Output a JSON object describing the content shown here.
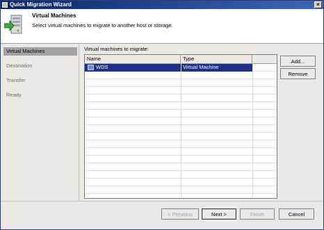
{
  "window": {
    "title": "Quick Migration Wizard"
  },
  "header": {
    "title": "Virtual Machines",
    "subtitle": "Select virtual machines to migrate to another host or storage."
  },
  "sidebar": {
    "items": [
      {
        "label": "Virtual Machines",
        "active": true
      },
      {
        "label": "Destination",
        "active": false
      },
      {
        "label": "Transfer",
        "active": false
      },
      {
        "label": "Ready",
        "active": false
      }
    ]
  },
  "main": {
    "list_label": "Virtual machines to migrate:",
    "columns": [
      "Name",
      "Type"
    ],
    "rows": [
      {
        "name": "WDS",
        "type": "Virtual Machine",
        "selected": true
      }
    ]
  },
  "side_buttons": {
    "add": "Add...",
    "remove": "Remove"
  },
  "footer": {
    "previous": "< Previous",
    "next": "Next >",
    "finish": "Finish",
    "cancel": "Cancel"
  },
  "colors": {
    "titlebar": "#0a246a",
    "selection": "#1f2f8c",
    "sidebar_active": "#a3a3a3"
  }
}
